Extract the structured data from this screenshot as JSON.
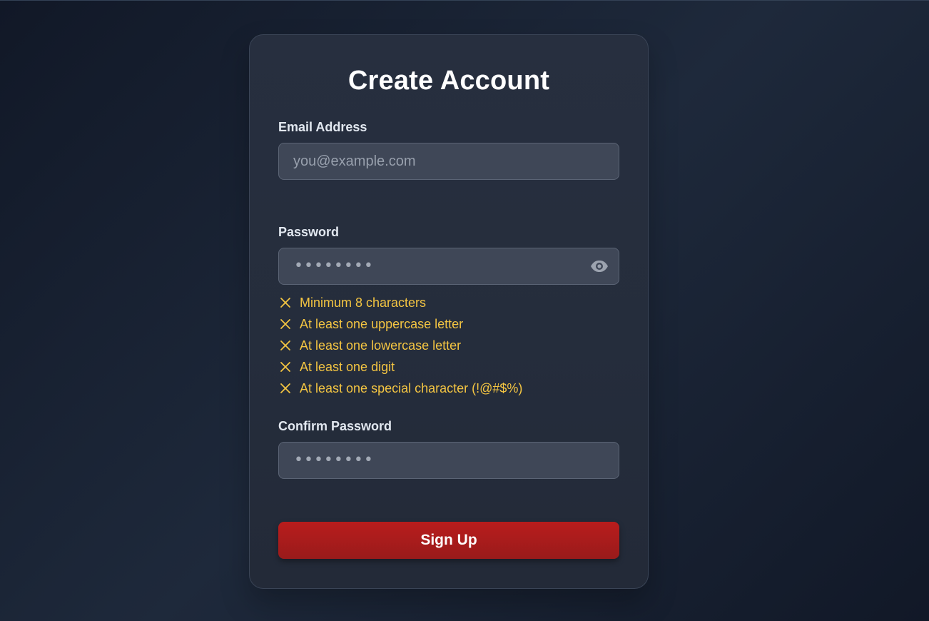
{
  "form": {
    "title": "Create Account",
    "email": {
      "label": "Email Address",
      "placeholder": "you@example.com",
      "value": ""
    },
    "password": {
      "label": "Password",
      "masked_value": "••••••••",
      "toggle_icon": "eye-icon"
    },
    "requirements": [
      {
        "text": "Minimum 8 characters",
        "status": "unmet",
        "icon": "x-icon"
      },
      {
        "text": "At least one uppercase letter",
        "status": "unmet",
        "icon": "x-icon"
      },
      {
        "text": "At least one lowercase letter",
        "status": "unmet",
        "icon": "x-icon"
      },
      {
        "text": "At least one digit",
        "status": "unmet",
        "icon": "x-icon"
      },
      {
        "text": "At least one special character (!@#$%)",
        "status": "unmet",
        "icon": "x-icon"
      }
    ],
    "confirm_password": {
      "label": "Confirm Password",
      "masked_value": "••••••••"
    },
    "submit_label": "Sign Up"
  },
  "colors": {
    "background": "#111827",
    "card": "#272f3f",
    "input_background": "#3f4757",
    "requirement_unmet": "#f4c542",
    "submit_button": "#b91c1c"
  }
}
